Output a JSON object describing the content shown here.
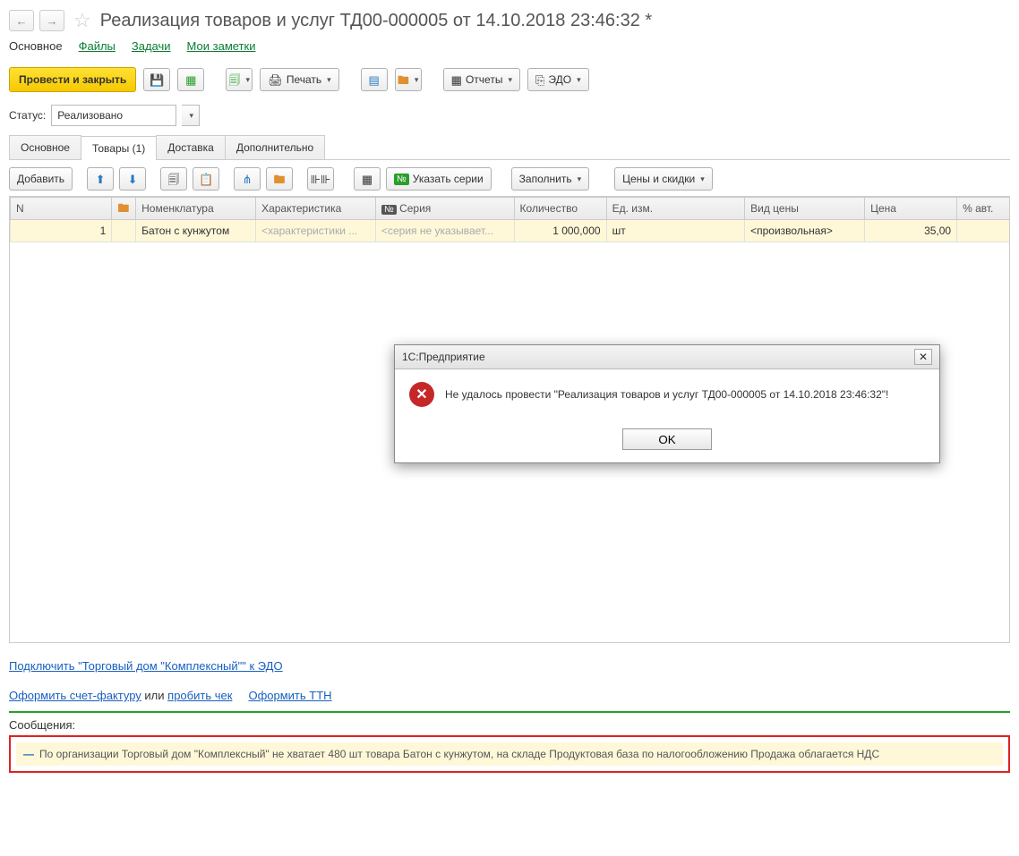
{
  "header": {
    "title": "Реализация товаров и услуг ТД00-000005 от 14.10.2018 23:46:32 *"
  },
  "nav": {
    "main": "Основное",
    "files": "Файлы",
    "tasks": "Задачи",
    "notes": "Мои заметки"
  },
  "toolbar": {
    "post_close": "Провести и закрыть",
    "print": "Печать",
    "reports": "Отчеты",
    "edo": "ЭДО"
  },
  "status": {
    "label": "Статус:",
    "value": "Реализовано"
  },
  "tabs": {
    "main": "Основное",
    "goods": "Товары (1)",
    "delivery": "Доставка",
    "extra": "Дополнительно"
  },
  "toolbar2": {
    "add": "Добавить",
    "series": "Указать серии",
    "fill": "Заполнить",
    "prices": "Цены и скидки"
  },
  "columns": {
    "n": "N",
    "nomenclature": "Номенклатура",
    "characteristic": "Характеристика",
    "series": "Серия",
    "qty": "Количество",
    "unit": "Ед. изм.",
    "pricetype": "Вид цены",
    "price": "Цена",
    "pctauto": "% авт."
  },
  "row": {
    "n": "1",
    "nomenclature": "Батон с кунжутом",
    "characteristic": "<характеристики ...",
    "series": "<серия не указывает...",
    "qty": "1 000,000",
    "unit": "шт",
    "pricetype": "<произвольная>",
    "price": "35,00"
  },
  "links": {
    "edo_connect": "Подключить \"Торговый дом \"Комплексный\"\" к ЭДО",
    "invoice": "Оформить счет-фактуру",
    "or": " или ",
    "check": "пробить чек",
    "ttn": "Оформить ТТН"
  },
  "messages": {
    "label": "Сообщения:",
    "text": "По организации Торговый дом \"Комплексный\" не хватает 480 шт товара Батон с кунжутом, на складе Продуктовая база  по налогообложению Продажа облагается НДС"
  },
  "dialog": {
    "title": "1С:Предприятие",
    "text": "Не удалось провести \"Реализация товаров и услуг ТД00-000005 от 14.10.2018 23:46:32\"!",
    "ok": "OK"
  }
}
